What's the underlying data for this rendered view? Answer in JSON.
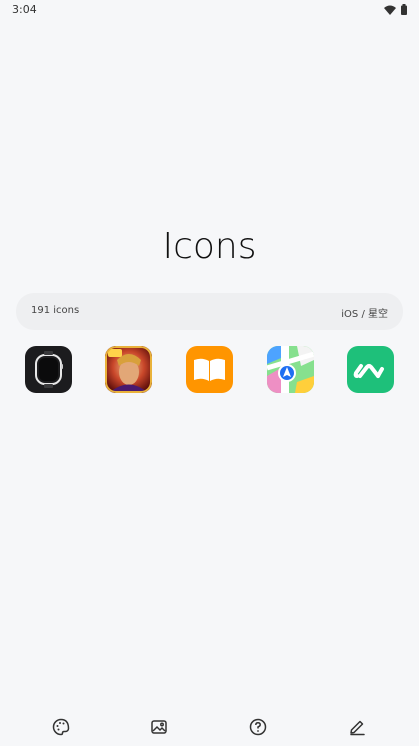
{
  "status_bar": {
    "time": "3:04",
    "wifi_icon": "wifi-icon",
    "battery_icon": "battery-icon"
  },
  "app": {
    "title": "Icons"
  },
  "info_bar": {
    "count_label": "191 icons",
    "pack_label": "iOS / 星空"
  },
  "icons": [
    {
      "name": "apple-watch-app-icon"
    },
    {
      "name": "honor-of-kings-game-icon"
    },
    {
      "name": "books-app-icon"
    },
    {
      "name": "maps-app-icon"
    },
    {
      "name": "green-a-app-icon"
    }
  ],
  "bottom_nav": [
    {
      "name": "palette-icon"
    },
    {
      "name": "wallpaper-icon"
    },
    {
      "name": "help-icon"
    },
    {
      "name": "edit-icon"
    }
  ],
  "colors": {
    "background": "#f6f7f9",
    "info_bar": "#eeeff1",
    "books_orange": "#ff9500",
    "app_green": "#1ec07a"
  }
}
